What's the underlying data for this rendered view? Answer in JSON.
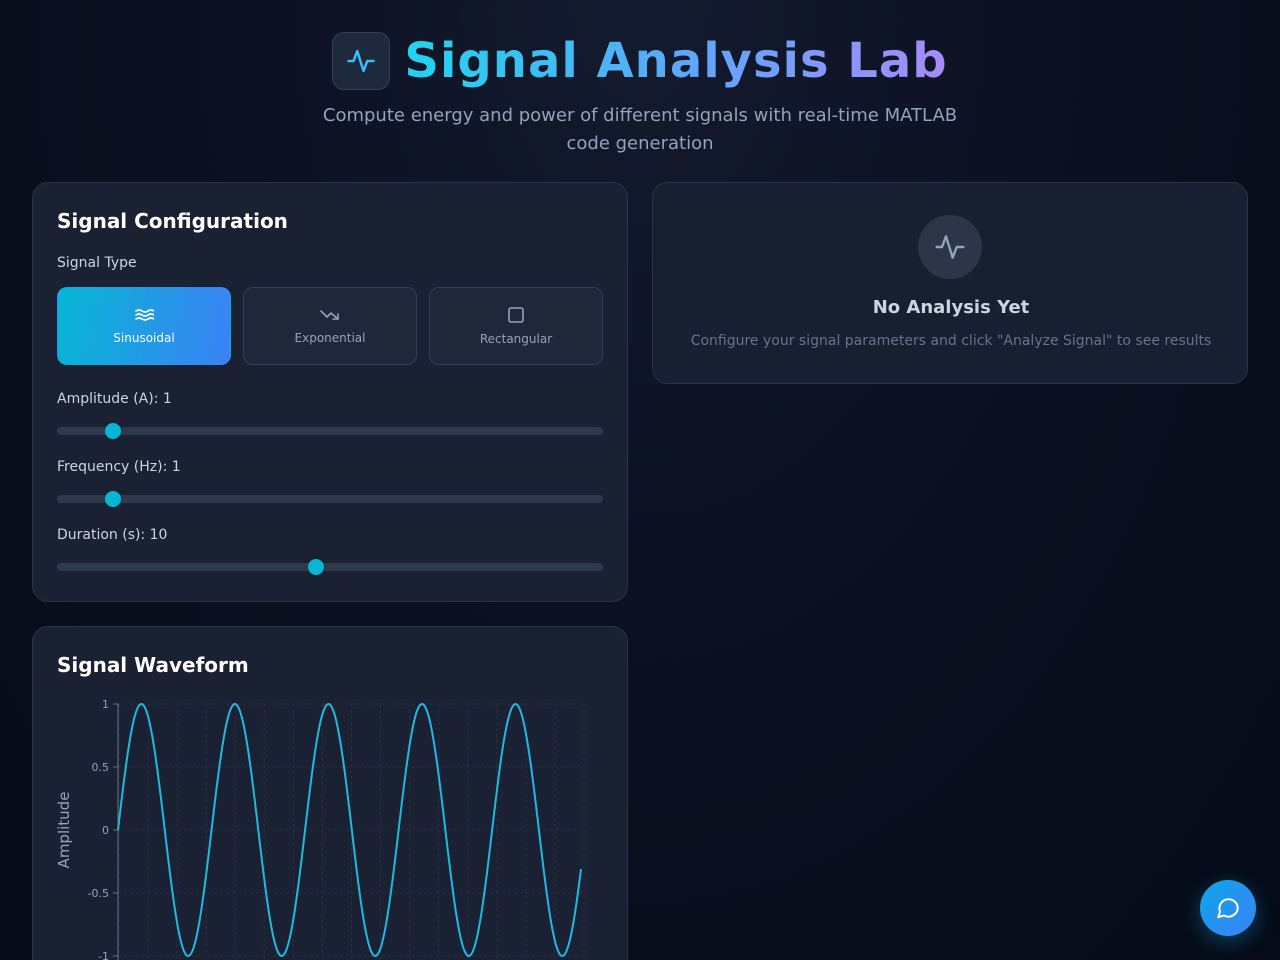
{
  "header": {
    "title": "Signal Analysis Lab",
    "subtitle": "Compute energy and power of different signals with real-time MATLAB code generation",
    "logo_icon": "activity-icon"
  },
  "config": {
    "title": "Signal Configuration",
    "signal_type_label": "Signal Type",
    "types": [
      {
        "label": "Sinusoidal",
        "icon": "wave-icon",
        "active": true
      },
      {
        "label": "Exponential",
        "icon": "trending-down-icon",
        "active": false
      },
      {
        "label": "Rectangular",
        "icon": "square-icon",
        "active": false
      }
    ],
    "amplitude_label": "Amplitude (A): 1",
    "frequency_label": "Frequency (Hz): 1",
    "duration_label": "Duration (s): 10",
    "amplitude_fraction": 0.102,
    "frequency_fraction": 0.102,
    "duration_fraction": 0.475
  },
  "result": {
    "empty_title": "No Analysis Yet",
    "empty_text": "Configure your signal parameters and click \"Analyze Signal\" to see results"
  },
  "waveform": {
    "title": "Signal Waveform"
  },
  "colors": {
    "accent": "#06b6d4",
    "line": "#22b8e0"
  },
  "chart_data": {
    "type": "line",
    "ylabel": "Amplitude",
    "xlabel": "",
    "y_ticks": [
      "1",
      "0.5",
      "0",
      "-0.5",
      "-1"
    ],
    "ylim": [
      -1,
      1
    ],
    "xlim": [
      0,
      10
    ],
    "function": "sin(2*pi*1*t)",
    "x_visible_range": [
      0,
      5
    ],
    "series": [
      {
        "x": [
          0,
          0.25,
          0.5,
          0.75,
          1,
          1.25,
          1.5,
          1.75,
          2,
          2.25,
          2.5,
          2.75,
          3,
          3.25,
          3.5,
          3.75,
          4,
          4.25,
          4.5,
          4.75,
          4.95
        ],
        "values": [
          0,
          1,
          0,
          -1,
          0,
          1,
          0,
          -1,
          0,
          1,
          0,
          -1,
          0,
          1,
          0,
          -1,
          0,
          1,
          0,
          -1,
          -0.07
        ]
      }
    ],
    "grid": true
  }
}
